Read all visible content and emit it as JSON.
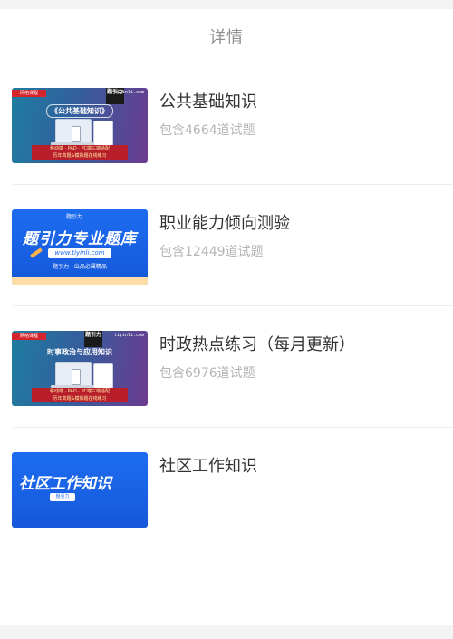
{
  "header": {
    "title": "详情"
  },
  "items": [
    {
      "title": "公共基础知识",
      "count": "包含4664道试题",
      "thumb": {
        "badge": "网络课程",
        "site": "tiyinli.com",
        "logo": "题引力",
        "heading": "《公共基础知识》",
        "banner_line1": "移动端 · PAD · PC端三端适配",
        "banner_line2": "历年真题&模拟题在线练习"
      }
    },
    {
      "title": "职业能力倾向测验",
      "count": "包含12449道试题",
      "thumb": {
        "brand": "题引力",
        "heading": "题引力专业题库",
        "url": "www.tiyinli.com",
        "sub": "题引力 · 出品必属精品"
      }
    },
    {
      "title": "时政热点练习（每月更新）",
      "count": "包含6976道试题",
      "thumb": {
        "badge": "网络课程",
        "site": "tiyinli.com",
        "logo": "题引力",
        "heading": "时事政治与应用知识",
        "banner_line1": "移动端 · PAD · PC端三端适配",
        "banner_line2": "历年真题&模拟题在线练习"
      }
    },
    {
      "title": "社区工作知识",
      "count": "",
      "thumb": {
        "heading": "社区工作知识",
        "sub": "题引力"
      }
    }
  ],
  "colors": {
    "header_text": "#8f8f8f",
    "title_text": "#333333",
    "count_text": "#b5b5b5",
    "divider": "#ececec",
    "brand_blue": "#1d6cf0",
    "badge_red": "#d5242c"
  }
}
